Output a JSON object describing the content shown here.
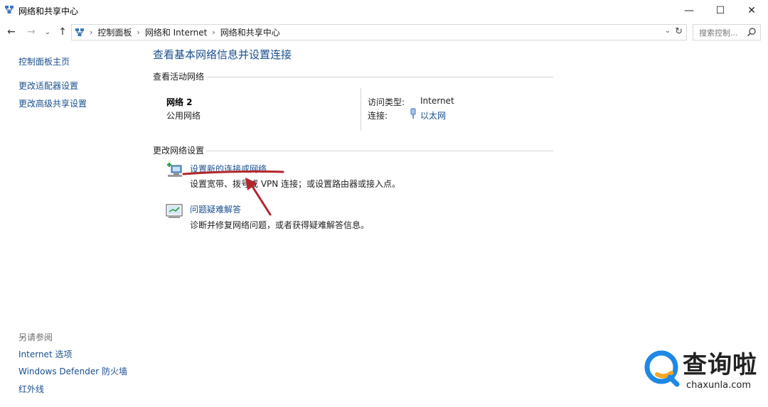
{
  "window": {
    "title": "网络和共享中心",
    "min_glyph": "—",
    "max_glyph": "☐",
    "close_glyph": "✕"
  },
  "nav": {
    "back_glyph": "←",
    "forward_glyph": "→",
    "dropdown_glyph": "⌄",
    "up_glyph": "↑",
    "breadcrumbs": [
      "控制面板",
      "网络和 Internet",
      "网络和共享中心"
    ],
    "crumb_separator": "›",
    "addr_dropdown_glyph": "⌄",
    "refresh_glyph": "↻",
    "search_placeholder": "搜索控制...",
    "search_icon": "search-icon"
  },
  "left": {
    "home": "控制面板主页",
    "links": [
      "更改适配器设置",
      "更改高级共享设置"
    ],
    "see_also_title": "另请参阅",
    "see_also": [
      "Internet 选项",
      "Windows Defender 防火墙",
      "红外线"
    ]
  },
  "main": {
    "title": "查看基本网络信息并设置连接",
    "active_section": "查看活动网络",
    "network_name": "网络 2",
    "network_category": "公用网络",
    "access_type_label": "访问类型:",
    "access_type_value": "Internet",
    "connection_label": "连接:",
    "connection_value": "以太网",
    "change_section": "更改网络设置",
    "tasks": [
      {
        "link": "设置新的连接或网络",
        "desc": "设置宽带、拨号或 VPN 连接；或设置路由器或接入点。",
        "icon": "new-connection-icon"
      },
      {
        "link": "问题疑难解答",
        "desc": "诊断并修复网络问题，或者获得疑难解答信息。",
        "icon": "troubleshoot-icon"
      }
    ]
  },
  "watermark": {
    "text": "查询啦",
    "sub": "chaxunla.com"
  },
  "colors": {
    "link": "#1a4f8e",
    "annotation": "#b3262b",
    "watermark_blue": "#1e88e5",
    "watermark_orange": "#f5a623"
  }
}
